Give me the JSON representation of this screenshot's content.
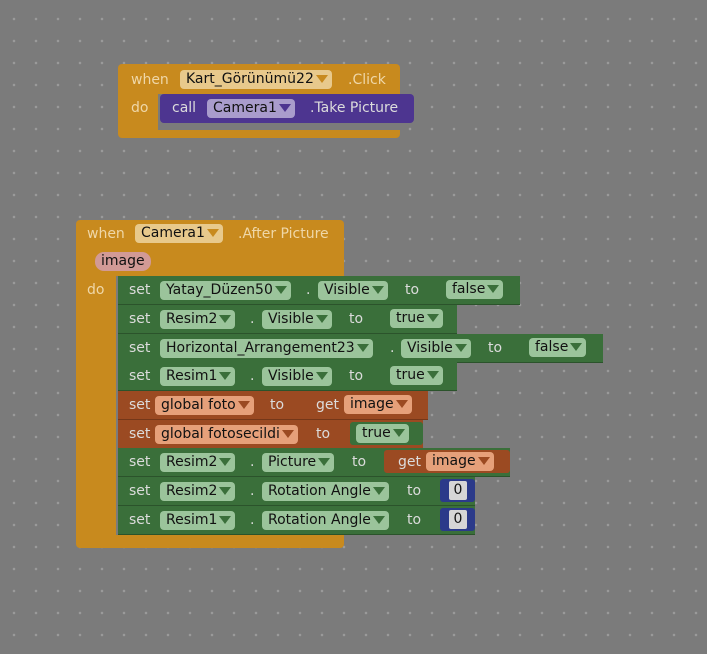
{
  "blocks": {
    "click_event": {
      "when": "when",
      "component": "Kart_Görünümü22",
      "event": ".Click",
      "do": "do",
      "call": {
        "call": "call",
        "component": "Camera1",
        "method": ".Take Picture"
      }
    },
    "after_picture": {
      "when": "when",
      "component": "Camera1",
      "event": ".After Picture",
      "param": "image",
      "do": "do",
      "statements": [
        {
          "set": "set",
          "component": "Yatay_Düzen50",
          "dot": ".",
          "property": "Visible",
          "to": "to",
          "value": "false"
        },
        {
          "set": "set",
          "component": "Resim2",
          "dot": ".",
          "property": "Visible",
          "to": "to",
          "value": "true"
        },
        {
          "set": "set",
          "component": "Horizontal_Arrangement23",
          "dot": ".",
          "property": "Visible",
          "to": "to",
          "value": "false"
        },
        {
          "set": "set",
          "component": "Resim1",
          "dot": ".",
          "property": "Visible",
          "to": "to",
          "value": "true"
        },
        {
          "set": "set",
          "variable": "global foto",
          "to": "to",
          "get": "get",
          "get_var": "image"
        },
        {
          "set": "set",
          "variable": "global fotosecildi",
          "to": "to",
          "value": "true"
        },
        {
          "set": "set",
          "component": "Resim2",
          "dot": ".",
          "property": "Picture",
          "to": "to",
          "get": "get",
          "get_var": "image"
        },
        {
          "set": "set",
          "component": "Resim2",
          "dot": ".",
          "property": "Rotation Angle",
          "to": "to",
          "number": "0"
        },
        {
          "set": "set",
          "component": "Resim1",
          "dot": ".",
          "property": "Rotation Angle",
          "to": "to",
          "number": "0"
        }
      ]
    }
  },
  "colors": {
    "event": "#c88a1e",
    "component_set": "#3a6f3a",
    "variable_set": "#9b4a22",
    "method_call": "#4d3590",
    "math": "#2b3a8a",
    "workspace": "#7b7b7b"
  }
}
